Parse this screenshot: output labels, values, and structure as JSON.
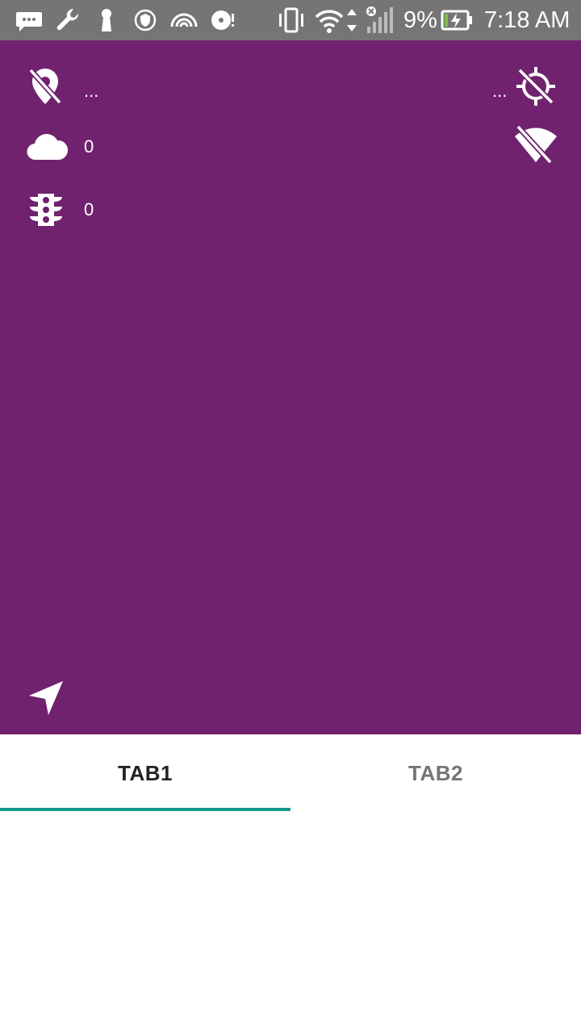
{
  "status_bar": {
    "battery_percent": "9%",
    "time": "7:18 AM",
    "icons": [
      "message-icon",
      "wrench-icon",
      "keyhole-icon",
      "shield-icon",
      "rainbow-icon",
      "disk-icon",
      "vibrate-icon",
      "wifi-icon",
      "data-arrows-icon",
      "signal-icon",
      "battery-charging-icon"
    ]
  },
  "hero": {
    "location_value": "...",
    "gps_value": "...",
    "cloud_value": "0",
    "traffic_value": "0",
    "icons": {
      "location": "location-off-icon",
      "gps": "gps-off-icon",
      "cloud": "cloud-icon",
      "wifi": "wifi-off-icon",
      "traffic": "traffic-light-icon",
      "navigation": "navigation-arrow-icon"
    },
    "background_color": "#70226e"
  },
  "tabs": {
    "items": [
      {
        "label": "TAB1",
        "active": true
      },
      {
        "label": "TAB2",
        "active": false
      }
    ],
    "indicator_color": "#139a8c"
  }
}
